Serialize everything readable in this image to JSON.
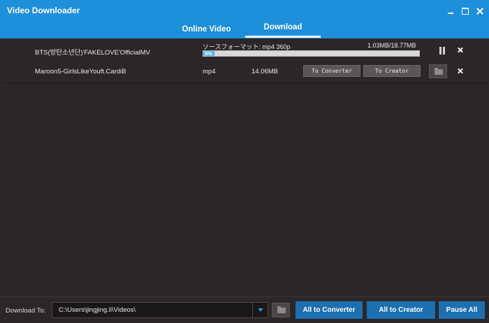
{
  "window": {
    "title": "Video Downloader",
    "accent_color": "#1e8fdb",
    "icons": [
      "minimize-icon",
      "maximize-icon",
      "close-icon"
    ]
  },
  "tabs": [
    {
      "label": "Online Video",
      "active": false
    },
    {
      "label": "Download",
      "active": true
    }
  ],
  "downloads": [
    {
      "filename": "BTS(방탄소년단)'FAKELOVE'OfficialMV",
      "status": "downloading",
      "source_format": "ソースフォーマット: mp4 360p",
      "size_progress": "1.03MB/18.77MB",
      "percent_label": "5%",
      "progress": 0.05,
      "progress_color": "#4fb3ea",
      "icons": [
        "pause-icon",
        "remove-icon"
      ]
    },
    {
      "filename": "Maroon5-GirlsLikeYouft.CardiB",
      "status": "completed",
      "format": "mp4",
      "size": "14.06MB",
      "to_converter_label": "To Converter",
      "to_creator_label": "To Creator",
      "icons": [
        "open-folder-icon",
        "remove-icon"
      ]
    }
  ],
  "bottom": {
    "download_to_label": "Download To:",
    "path_value": "C:\\Users\\jingjing.li\\Videos\\",
    "all_to_converter_label": "All to Converter",
    "all_to_creator_label": "All to Creator",
    "pause_all_label": "Pause All",
    "button_color": "#1c6fb1",
    "icons": [
      "dropdown-arrow-icon",
      "browse-folder-icon"
    ]
  }
}
